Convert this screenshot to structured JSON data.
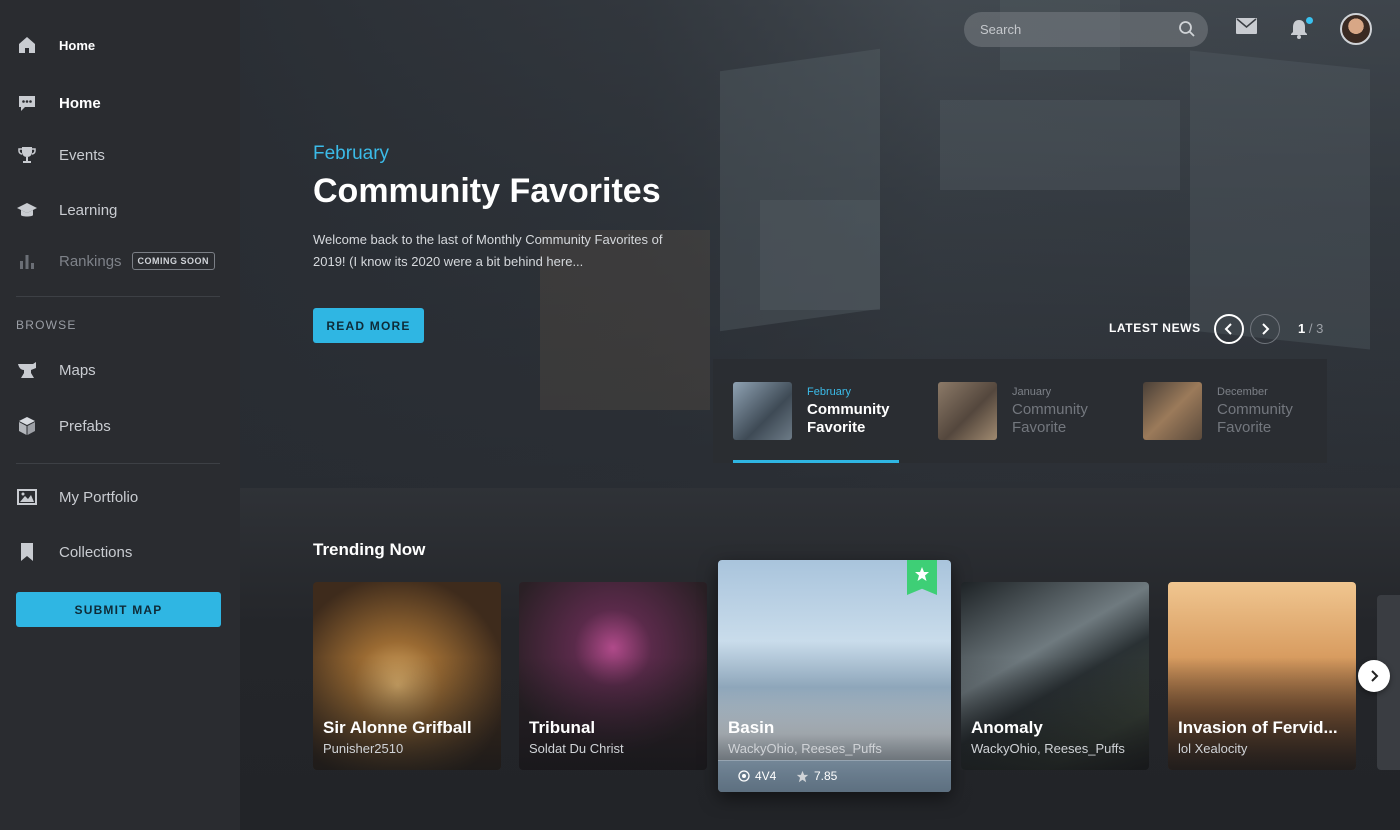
{
  "sidebar": {
    "items": [
      {
        "label": "Home",
        "icon": "home-icon"
      },
      {
        "label": "Home",
        "icon": "chat-icon"
      },
      {
        "label": "Events",
        "icon": "trophy-icon"
      },
      {
        "label": "Learning",
        "icon": "graduation-cap-icon"
      },
      {
        "label": "Rankings",
        "icon": "bar-chart-icon",
        "badge": "COMING SOON"
      }
    ],
    "browse_label": "BROWSE",
    "browse_items": [
      {
        "label": "Maps",
        "icon": "anvil-icon"
      },
      {
        "label": "Prefabs",
        "icon": "cube-icon"
      }
    ],
    "personal_items": [
      {
        "label": "My Portfolio",
        "icon": "image-icon"
      },
      {
        "label": "Collections",
        "icon": "bookmark-icon"
      }
    ],
    "submit_label": "SUBMIT MAP"
  },
  "topbar": {
    "search_placeholder": "Search"
  },
  "hero": {
    "month": "February",
    "title": "Community Favorites",
    "description": "Welcome back to the last of  Monthly Community Favorites of 2019! (I know its 2020 were a bit behind here...",
    "cta": "READ MORE",
    "latest_news_label": "LATEST NEWS",
    "page_current": "1",
    "page_total": "/ 3"
  },
  "news": [
    {
      "month": "February",
      "title": "Community Favorite"
    },
    {
      "month": "January",
      "title": "Community Favorite"
    },
    {
      "month": "December",
      "title": "Community Favorite"
    }
  ],
  "trending": {
    "title": "Trending Now",
    "cards": [
      {
        "title": "Sir Alonne Grifball",
        "author": "Punisher2510"
      },
      {
        "title": "Tribunal",
        "author": "Soldat Du Christ"
      },
      {
        "title": "Basin",
        "author": "WackyOhio, Reeses_Puffs",
        "mode": "4V4",
        "rating": "7.85"
      },
      {
        "title": "Anomaly",
        "author": "WackyOhio, Reeses_Puffs"
      },
      {
        "title": "Invasion of Fervid...",
        "author": "lol Xealocity"
      }
    ]
  },
  "colors": {
    "accent": "#2fb6e3",
    "sidebar_bg": "#2a2c30",
    "favorite_flag": "#3ecf76"
  }
}
